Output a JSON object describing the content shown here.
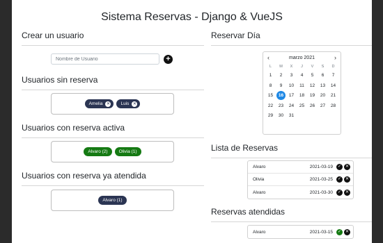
{
  "title": "Sistema Reservas - Django & VueJS",
  "crear_usuario": {
    "heading": "Crear un usuario",
    "placeholder": "Nombre de Usuario",
    "add_icon": "plus-circle-icon"
  },
  "usuarios_sin_reserva": {
    "heading": "Usuarios sin reserva",
    "chips": [
      {
        "name": "Amelia"
      },
      {
        "name": "Luis"
      }
    ]
  },
  "usuarios_reserva_activa": {
    "heading": "Usuarios con reserva activa",
    "chips": [
      {
        "label": "Alvaro (2)"
      },
      {
        "label": "Olivia (1)"
      }
    ]
  },
  "usuarios_reserva_atendida": {
    "heading": "Usuarios con reserva ya atendida",
    "chips": [
      {
        "label": "Alvaro (1)"
      }
    ]
  },
  "reservar_dia": {
    "heading": "Reservar Día",
    "calendar": {
      "month": "marzo 2021",
      "prev": "‹",
      "next": "›",
      "weekdays": [
        "L",
        "M",
        "X",
        "J",
        "V",
        "S",
        "D"
      ],
      "weeks": [
        [
          "1",
          "2",
          "3",
          "4",
          "5",
          "6",
          "7"
        ],
        [
          "8",
          "9",
          "10",
          "11",
          "12",
          "13",
          "14"
        ],
        [
          "15",
          "16",
          "17",
          "18",
          "19",
          "20",
          "21"
        ],
        [
          "22",
          "23",
          "24",
          "25",
          "26",
          "27",
          "28"
        ],
        [
          "29",
          "30",
          "31",
          "",
          "",
          "",
          ""
        ]
      ],
      "selected_day": "16"
    }
  },
  "lista_reservas": {
    "heading": "Lista de Reservas",
    "rows": [
      {
        "name": "Alvaro",
        "date": "2021-03-19"
      },
      {
        "name": "Olivia",
        "date": "2021-03-25"
      },
      {
        "name": "Alvaro",
        "date": "2021-03-30"
      }
    ]
  },
  "reservas_atendidas": {
    "heading": "Reservas atendidas",
    "rows": [
      {
        "name": "Alvaro",
        "date": "2021-03-15"
      }
    ]
  },
  "colors": {
    "navy_chip": "#2b3553",
    "green_chip": "#157a13",
    "today": "#1e88e5"
  }
}
